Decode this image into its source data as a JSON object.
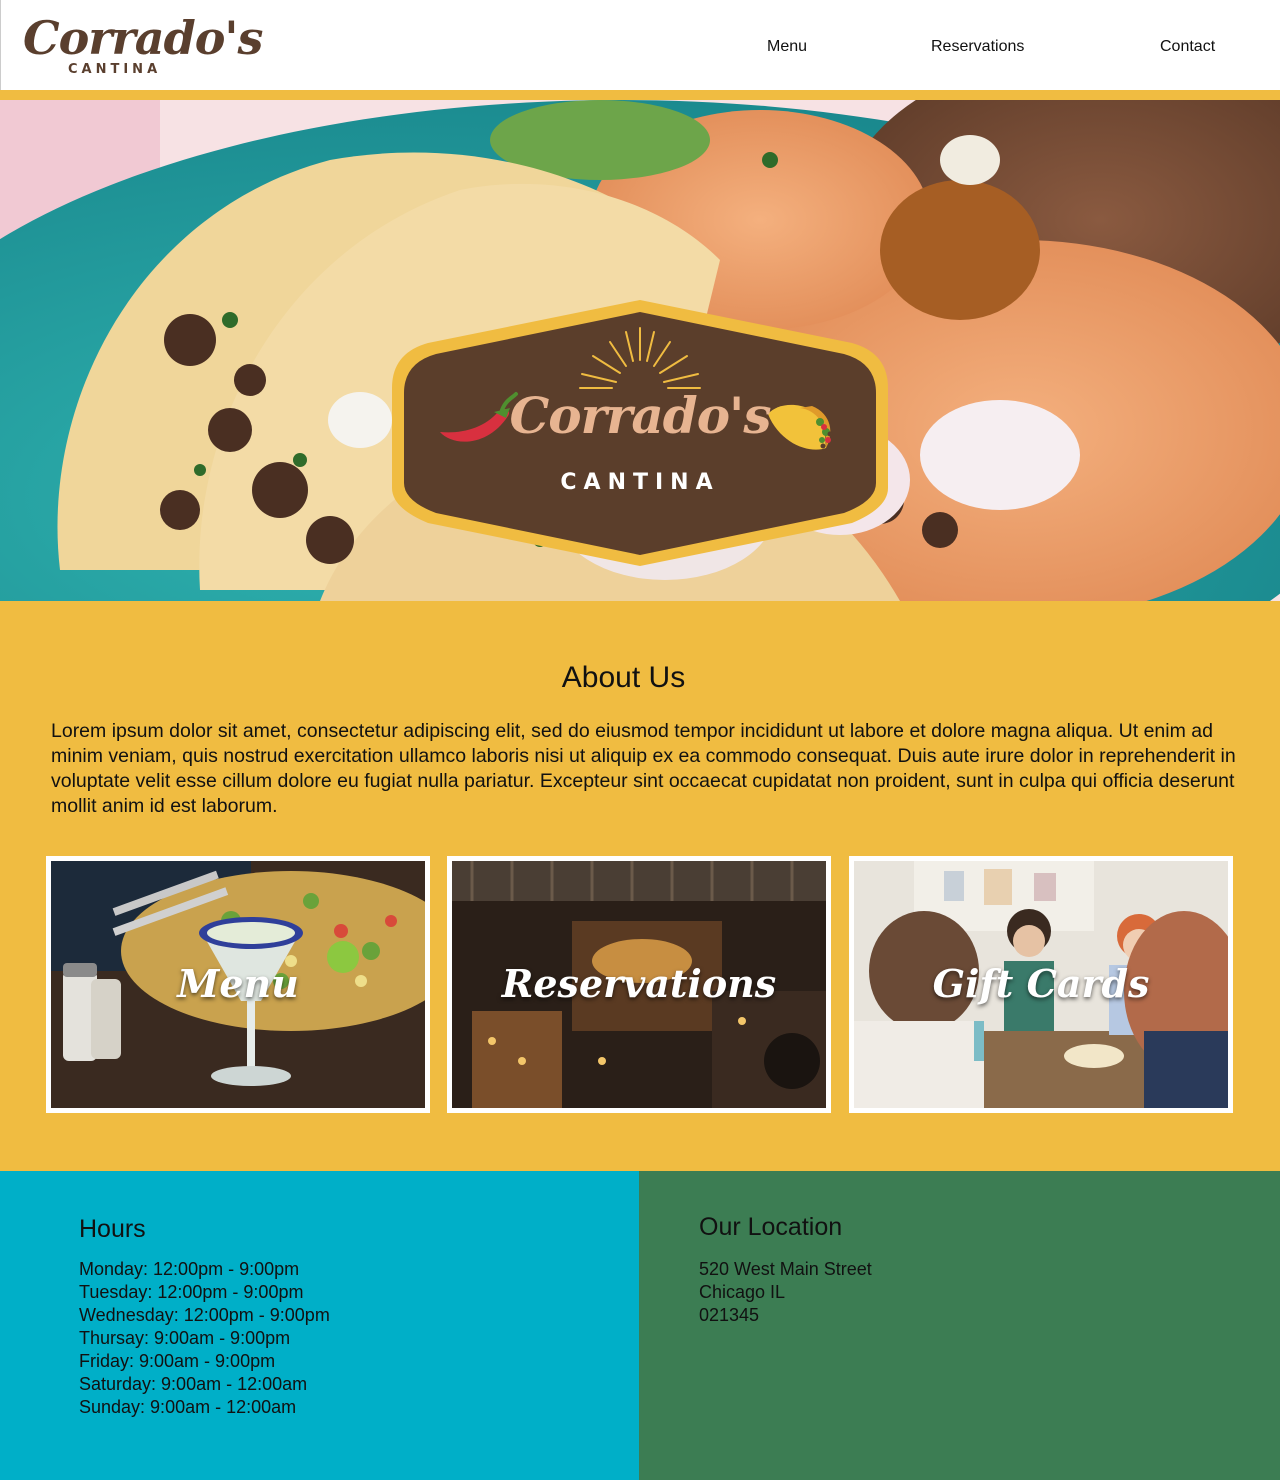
{
  "header": {
    "brand_word": "Corrado's",
    "brand_sub": "CANTINA",
    "nav": [
      "Menu",
      "Reservations",
      "Contact"
    ]
  },
  "hero": {
    "badge_word": "Corrado's",
    "badge_sub": "CANTINA"
  },
  "about": {
    "title": "About Us",
    "text": "Lorem ipsum dolor sit amet, consectetur adipiscing elit, sed do eiusmod tempor incididunt ut labore et dolore magna aliqua. Ut enim ad minim veniam, quis nostrud exercitation ullamco laboris nisi ut aliquip ex ea commodo consequat. Duis aute irure dolor in reprehenderit in voluptate velit esse cillum dolore eu fugiat nulla pariatur. Excepteur sint occaecat cupidatat non proident, sunt in culpa qui officia deserunt mollit anim id est laborum."
  },
  "cards": [
    "Menu",
    "Reservations",
    "Gift Cards"
  ],
  "hours": {
    "title": "Hours",
    "lines": [
      "Monday: 12:00pm - 9:00pm",
      "Tuesday: 12:00pm - 9:00pm",
      "Wednesday: 12:00pm - 9:00pm",
      "Thursay: 9:00am - 9:00pm",
      "Friday: 9:00am - 9:00pm",
      "Saturday: 9:00am - 12:00am",
      "Sunday: 9:00am - 12:00am"
    ]
  },
  "location": {
    "title": "Our Location",
    "lines": [
      "520 West Main Street",
      "Chicago IL",
      "021345"
    ]
  },
  "colors": {
    "accent_yellow": "#f0bc41",
    "brand_brown": "#5a3f2e",
    "hours_bg": "#00afc8",
    "location_bg": "#3c7d53"
  }
}
